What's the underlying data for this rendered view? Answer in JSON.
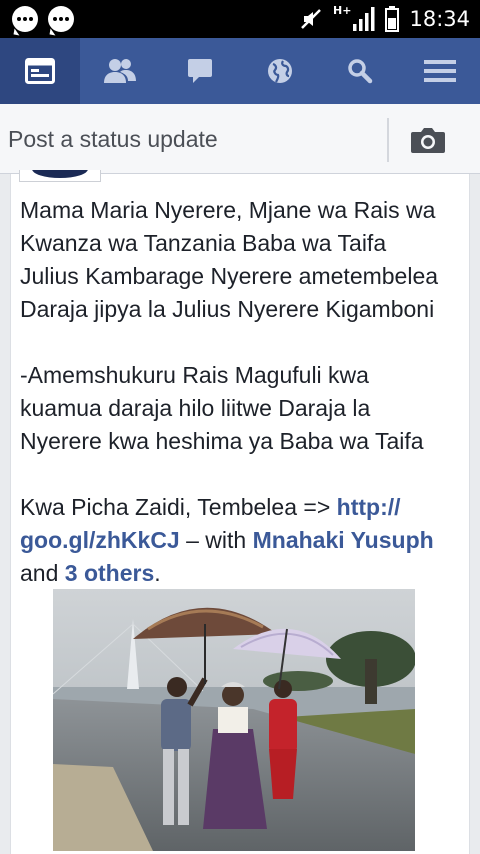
{
  "status_bar": {
    "time": "18:34",
    "network": "H+",
    "icons": [
      "chat-bubble-icon",
      "chat-bubble-icon",
      "mute-icon",
      "signal-icon",
      "battery-icon"
    ]
  },
  "nav": {
    "items": [
      {
        "name": "news-feed",
        "icon": "newsfeed-icon",
        "active": true
      },
      {
        "name": "friend-requests",
        "icon": "friends-icon",
        "active": false
      },
      {
        "name": "messages",
        "icon": "chat-icon",
        "active": false
      },
      {
        "name": "notifications",
        "icon": "globe-icon",
        "active": false
      },
      {
        "name": "search",
        "icon": "search-icon",
        "active": false
      },
      {
        "name": "more",
        "icon": "menu-icon",
        "active": false
      }
    ],
    "color": "#3b5998",
    "active_color": "#2e4780"
  },
  "composer": {
    "placeholder": "Post a status update",
    "camera_icon": "camera-icon"
  },
  "post": {
    "paragraph1": "Mama Maria Nyerere, Mjane wa Rais wa\nKwanza wa Tanzania Baba wa Taifa\nJulius Kambarage Nyerere ametembelea\nDaraja jipya la Julius Nyerere Kigamboni",
    "paragraph2": "-Amemshukuru Rais Magufuli kwa\nkuamua daraja hilo liitwe Daraja la\nNyerere kwa heshima ya Baba wa Taifa",
    "para3_prefix": "Kwa Picha Zaidi, Tembelea => ",
    "link_line1": "http://",
    "link_line2": "goo.gl/zhKkCJ",
    "with_text": " – with ",
    "tagged_person": "Mnahaki Yusuph",
    "and_text": "and ",
    "others_text": "3 others",
    "end_text": ".",
    "link_color": "#3b5998",
    "photo": "photo of three people standing under umbrellas on a rainy bridge road"
  }
}
